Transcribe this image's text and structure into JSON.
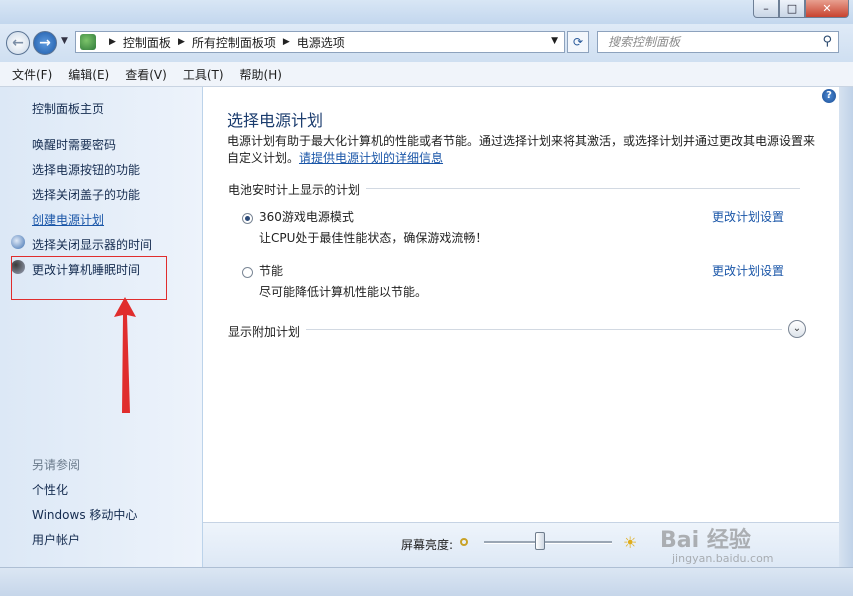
{
  "address": {
    "crumbs": [
      "控制面板",
      "所有控制面板项",
      "电源选项"
    ],
    "search_placeholder": "搜索控制面板"
  },
  "menu": [
    "文件(F)",
    "编辑(E)",
    "查看(V)",
    "工具(T)",
    "帮助(H)"
  ],
  "sidebar": {
    "home": "控制面板主页",
    "links": [
      "唤醒时需要密码",
      "选择电源按钮的功能",
      "选择关闭盖子的功能",
      "创建电源计划",
      "选择关闭显示器的时间",
      "更改计算机睡眠时间"
    ],
    "see_also_title": "另请参阅",
    "see_also": [
      "个性化",
      "Windows 移动中心",
      "用户帐户"
    ]
  },
  "main": {
    "title": "选择电源计划",
    "desc": "电源计划有助于最大化计算机的性能或者节能。通过选择计划来将其激活，或选择计划并通过更改其电源设置来自定义计划。",
    "desc_link": "请提供电源计划的详细信息",
    "group_label": "电池安时计上显示的计划",
    "plans": [
      {
        "name": "360游戏电源模式",
        "desc": "让CPU处于最佳性能状态，确保游戏流畅！",
        "link": "更改计划设置",
        "selected": true
      },
      {
        "name": "节能",
        "desc": "尽可能降低计算机性能以节能。",
        "link": "更改计划设置",
        "selected": false
      }
    ],
    "more_label": "显示附加计划"
  },
  "brightness": {
    "label": "屏幕亮度:",
    "level": 0.44
  },
  "watermark": {
    "main": "Bai 经验",
    "sub": "jingyan.baidu.com"
  },
  "colors": {
    "link": "#1a56a8",
    "annotation": "#e02d2d"
  }
}
